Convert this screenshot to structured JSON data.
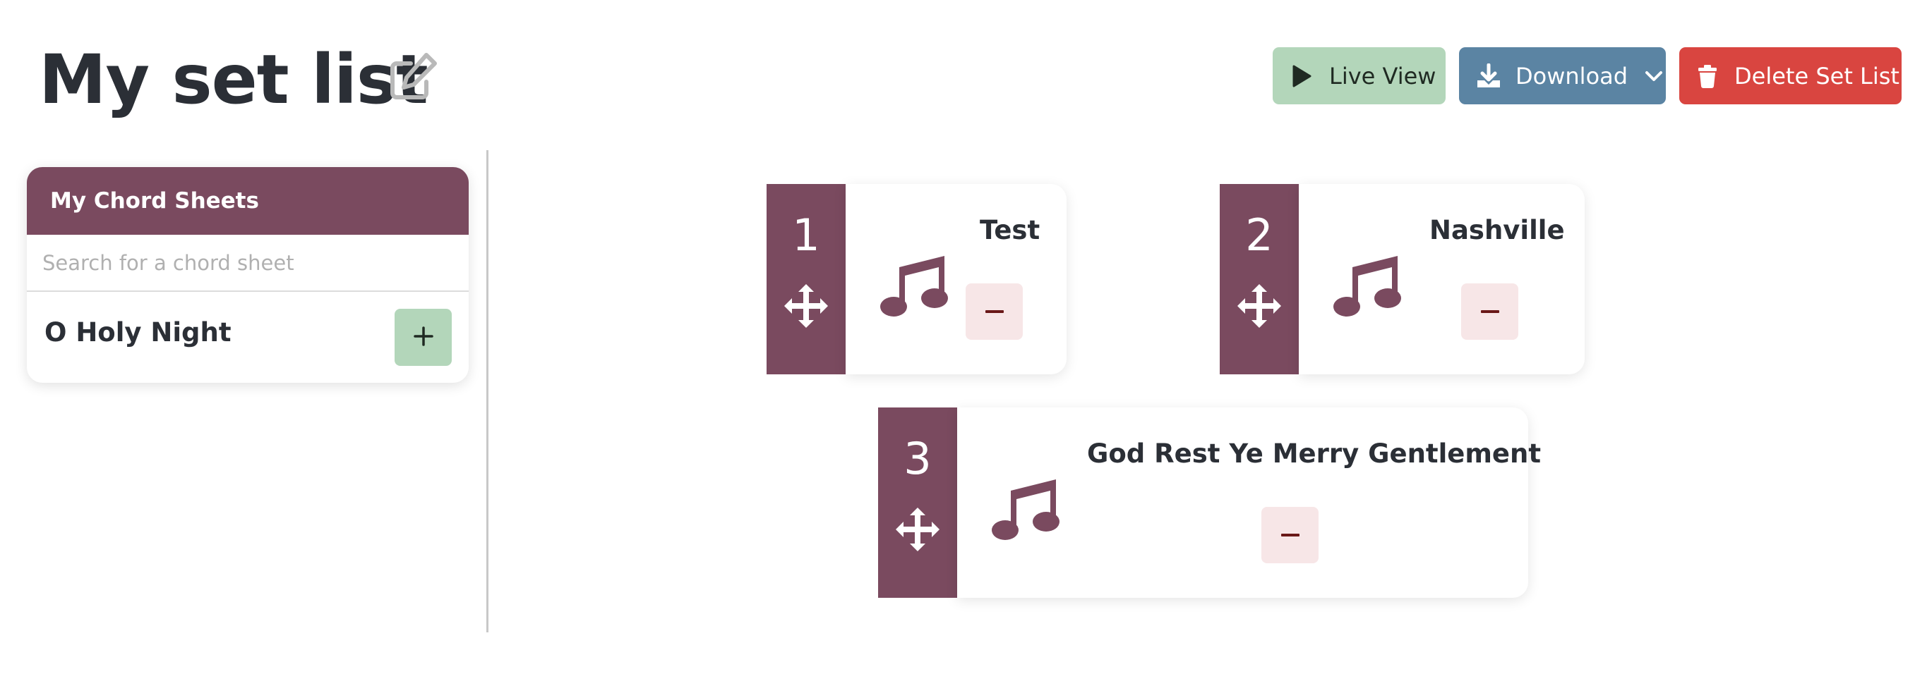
{
  "page": {
    "title": "My set list"
  },
  "toolbar": {
    "live_view_label": "Live View",
    "download_label": "Download",
    "delete_label": "Delete Set List"
  },
  "sidebar": {
    "header": "My Chord Sheets",
    "search_placeholder": "Search for a chord sheet",
    "items": [
      {
        "title": "O Holy Night"
      }
    ]
  },
  "setlist": {
    "songs": [
      {
        "number": "1",
        "title": "Test"
      },
      {
        "number": "2",
        "title": "Nashville"
      },
      {
        "number": "3",
        "title": "God Rest Ye Merry Gentlement"
      }
    ]
  },
  "colors": {
    "brand": "#7a4a5f",
    "live_view": "#b3d6ba",
    "download": "#5b84a3",
    "delete": "#d94540",
    "remove_bg": "#f7e6e7"
  },
  "icons": {
    "edit": "pencil-square-icon",
    "live_view": "play-icon",
    "download": "download-icon",
    "dropdown": "chevron-down-icon",
    "delete": "trash-icon",
    "add": "plus-icon",
    "drag": "move-icon",
    "song": "music-note-icon",
    "remove": "minus-icon"
  }
}
